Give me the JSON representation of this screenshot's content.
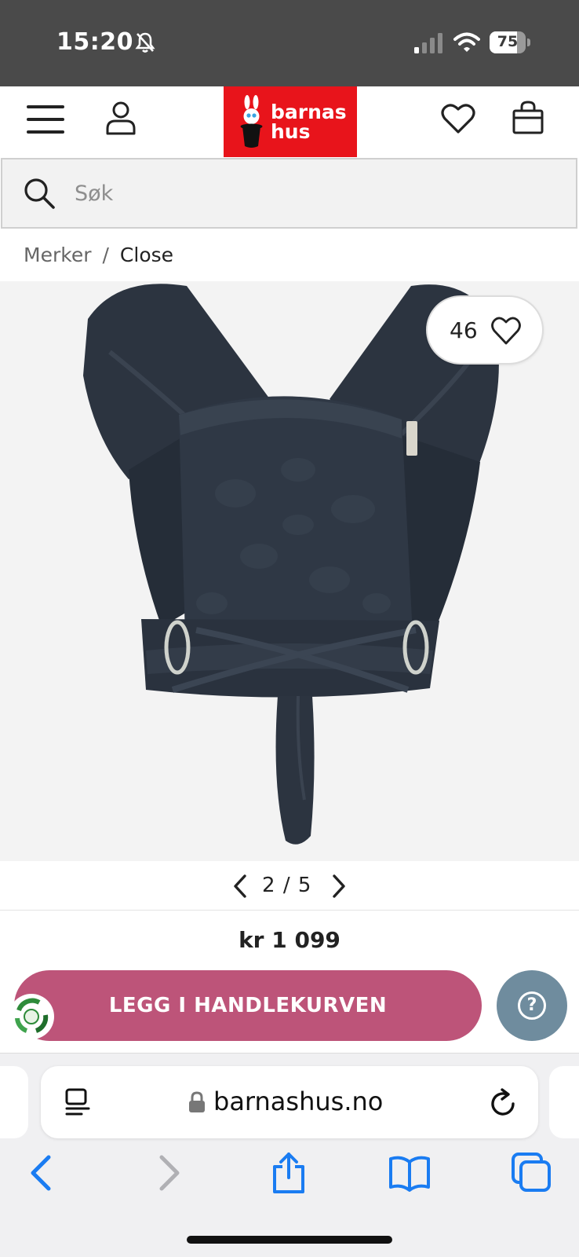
{
  "status_bar": {
    "time": "15:20",
    "battery_level": "75",
    "battery_fraction": 0.75
  },
  "header": {
    "logo_line1": "barnas",
    "logo_line2": "hus",
    "brand_color": "#e8141b"
  },
  "search": {
    "placeholder": "Søk"
  },
  "breadcrumb": {
    "items": [
      "Merker",
      "Close"
    ],
    "separator": "/"
  },
  "product": {
    "wishlist_count": "46",
    "gallery_current": "2",
    "gallery_total": "5",
    "gallery_separator": "/",
    "price": "kr 1 099",
    "add_to_cart_label": "LEGG I HANDLEKURVEN",
    "accent_color": "#bd5479",
    "help_label": "?"
  },
  "browser": {
    "url": "barnashus.no"
  },
  "icons": {
    "menu": "hamburger-menu-icon",
    "account": "user-icon",
    "wishlist": "heart-icon",
    "cart": "shopping-bag-icon",
    "search": "search-icon",
    "help": "question-icon",
    "reload": "reload-icon",
    "share": "share-icon",
    "bookmarks": "book-icon",
    "tabs": "tabs-icon"
  }
}
